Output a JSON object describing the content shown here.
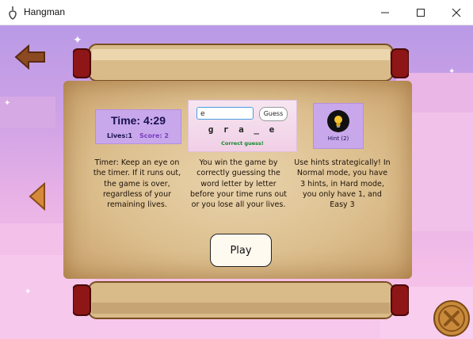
{
  "window": {
    "title": "Hangman",
    "minimize_icon": "minimize-icon",
    "maximize_icon": "maximize-icon",
    "close_icon": "close-icon"
  },
  "timer_card": {
    "time": "Time: 4:29",
    "lives": "Lives:1",
    "score": "Score: 2"
  },
  "guess_card": {
    "input_value": "e",
    "guess_label": "Guess",
    "word": "g r a _ e",
    "feedback": "Correct guess!"
  },
  "hint_card": {
    "icon": "lightbulb-icon",
    "label": "Hint (2)"
  },
  "descriptions": {
    "timer": "Timer: Keep an eye on the timer. If it runs out, the game is over, regardless of your remaining lives.",
    "guess": "You win the game by correctly guessing the word letter by letter before your time runs out or you lose all your lives.",
    "hints": "Use hints strategically! In Normal mode, you have 3 hints, in Hard mode, you only have 1, and Easy 3"
  },
  "play_label": "Play",
  "colors": {
    "parchment": "#dcbf8e",
    "card_purple": "#c8a8ea",
    "feedback_green": "#0f8a2a",
    "score_purple": "#7a3bbf"
  }
}
